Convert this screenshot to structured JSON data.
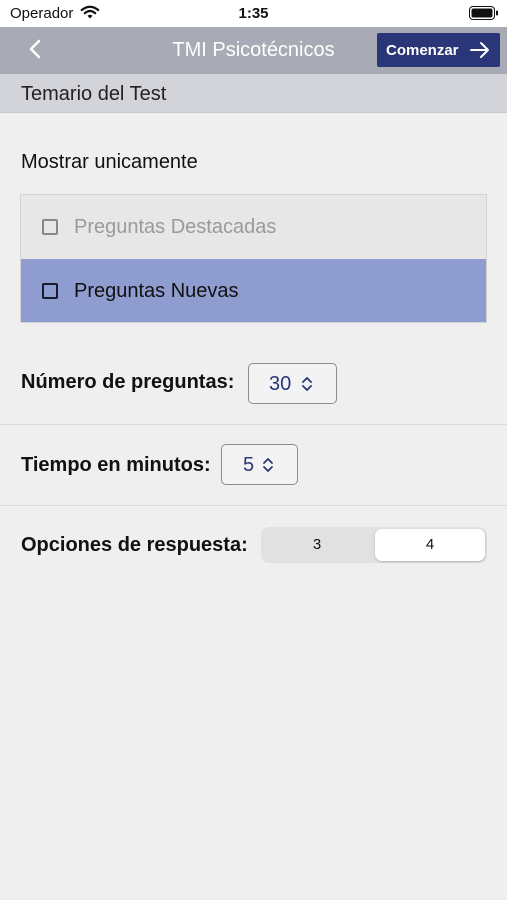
{
  "status_bar": {
    "carrier": "Operador",
    "time": "1:35"
  },
  "nav": {
    "title": "TMI Psicotécnicos",
    "start_label": "Comenzar",
    "back_icon": "chevron-left-icon"
  },
  "section": {
    "header": "Temario del Test"
  },
  "filter": {
    "title": "Mostrar unicamente",
    "options": [
      {
        "label": "Preguntas Destacadas",
        "checked": false,
        "enabled": false
      },
      {
        "label": "Preguntas Nuevas",
        "checked": false,
        "enabled": true
      }
    ]
  },
  "questions": {
    "label": "Número de preguntas:",
    "value": "30"
  },
  "time": {
    "label": "Tiempo en minutos:",
    "value": "5"
  },
  "answers": {
    "label": "Opciones de respuesta:",
    "options": [
      "3",
      "4"
    ],
    "selected": "4"
  },
  "colors": {
    "nav_bg": "#a8abb5",
    "primary": "#2a3677",
    "highlight_row": "#8f9ccf"
  }
}
